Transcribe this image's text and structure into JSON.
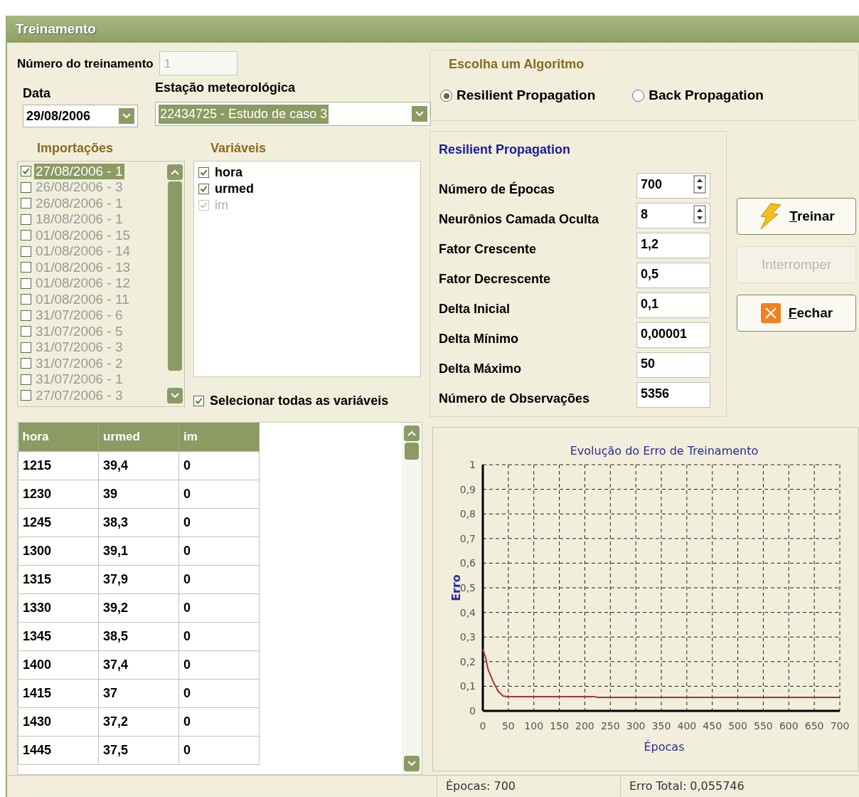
{
  "window": {
    "title": "Treinamento"
  },
  "training_number": {
    "label": "Número do treinamento",
    "value": "1",
    "disabled": true
  },
  "date": {
    "label": "Data",
    "value": "29/08/2006"
  },
  "station": {
    "label": "Estação meteorológica",
    "value": "22434725 - Estudo de caso 3",
    "selected": true
  },
  "imports": {
    "title": "Importações",
    "items": [
      {
        "label": "27/08/2006 - 1",
        "checked": true,
        "selected": true
      },
      {
        "label": "26/08/2006 - 3",
        "checked": false,
        "selected": false
      },
      {
        "label": "26/08/2006 - 1",
        "checked": false,
        "selected": false
      },
      {
        "label": "18/08/2006 - 1",
        "checked": false,
        "selected": false
      },
      {
        "label": "01/08/2006 - 15",
        "checked": false,
        "selected": false
      },
      {
        "label": "01/08/2006 - 14",
        "checked": false,
        "selected": false
      },
      {
        "label": "01/08/2006 - 13",
        "checked": false,
        "selected": false
      },
      {
        "label": "01/08/2006 - 12",
        "checked": false,
        "selected": false
      },
      {
        "label": "01/08/2006 - 11",
        "checked": false,
        "selected": false
      },
      {
        "label": "31/07/2006 - 6",
        "checked": false,
        "selected": false
      },
      {
        "label": "31/07/2006 - 5",
        "checked": false,
        "selected": false
      },
      {
        "label": "31/07/2006 - 3",
        "checked": false,
        "selected": false
      },
      {
        "label": "31/07/2006 - 2",
        "checked": false,
        "selected": false
      },
      {
        "label": "31/07/2006 - 1",
        "checked": false,
        "selected": false
      },
      {
        "label": "27/07/2006 - 3",
        "checked": false,
        "selected": false
      }
    ]
  },
  "variables": {
    "title": "Variáveis",
    "items": [
      {
        "label": "hora",
        "checked": true,
        "disabled": false
      },
      {
        "label": "urmed",
        "checked": true,
        "disabled": false
      },
      {
        "label": "im",
        "checked": true,
        "disabled": true
      }
    ],
    "select_all": {
      "label": "Selecionar todas as variáveis",
      "checked": true
    }
  },
  "table": {
    "columns": [
      "hora",
      "urmed",
      "im"
    ],
    "rows": [
      [
        "1215",
        "39,4",
        "0"
      ],
      [
        "1230",
        "39",
        "0"
      ],
      [
        "1245",
        "38,3",
        "0"
      ],
      [
        "1300",
        "39,1",
        "0"
      ],
      [
        "1315",
        "37,9",
        "0"
      ],
      [
        "1330",
        "39,2",
        "0"
      ],
      [
        "1345",
        "38,5",
        "0"
      ],
      [
        "1400",
        "37,4",
        "0"
      ],
      [
        "1415",
        "37",
        "0"
      ],
      [
        "1430",
        "37,2",
        "0"
      ],
      [
        "1445",
        "37,5",
        "0"
      ]
    ]
  },
  "algorithm": {
    "title": "Escolha um Algoritmo",
    "options": [
      {
        "label": "Resilient Propagation",
        "selected": true
      },
      {
        "label": "Back Propagation",
        "selected": false
      }
    ]
  },
  "parameters": {
    "title": "Resilient Propagation",
    "fields": [
      {
        "label": "Número de Épocas",
        "value": "700",
        "kind": "spin"
      },
      {
        "label": "Neurônios Camada Oculta",
        "value": "8",
        "kind": "spin"
      },
      {
        "label": "Fator Crescente",
        "value": "1,2",
        "kind": "text"
      },
      {
        "label": "Fator Decrescente",
        "value": "0,5",
        "kind": "text"
      },
      {
        "label": "Delta Inicial",
        "value": "0,1",
        "kind": "text"
      },
      {
        "label": "Delta Mínimo",
        "value": "0,00001",
        "kind": "text"
      },
      {
        "label": "Delta Máximo",
        "value": "50",
        "kind": "text"
      },
      {
        "label": "Número de Observações",
        "value": "5356",
        "kind": "text"
      }
    ]
  },
  "buttons": [
    {
      "label": "Treinar",
      "kind": "train",
      "disabled": false
    },
    {
      "label": "Interromper",
      "kind": "plain",
      "disabled": true
    },
    {
      "label": "Fechar",
      "kind": "close",
      "disabled": false
    }
  ],
  "chart": {
    "chart_data": {
      "type": "line",
      "title": "Evolução do Erro de Treinamento",
      "xlabel": "Épocas",
      "ylabel": "Erro",
      "x": [
        0,
        5,
        10,
        20,
        30,
        40,
        50,
        100,
        150,
        200,
        220,
        225,
        300,
        400,
        500,
        600,
        700
      ],
      "grid": true,
      "series": [
        {
          "color": "#b03040",
          "values": [
            0.25,
            0.22,
            0.17,
            0.12,
            0.08,
            0.06,
            0.058,
            0.058,
            0.058,
            0.058,
            0.058,
            0.055,
            0.055,
            0.055,
            0.055,
            0.055,
            0.055
          ]
        }
      ],
      "xlim": [
        0,
        700
      ],
      "ylim": [
        0,
        1
      ],
      "xticks": [
        0,
        50,
        100,
        150,
        200,
        250,
        300,
        350,
        400,
        450,
        500,
        550,
        600,
        650,
        700
      ],
      "yticks": [
        {
          "value": 0,
          "label": "0"
        },
        {
          "value": 0.1,
          "label": "0,1"
        },
        {
          "value": 0.2,
          "label": "0,2"
        },
        {
          "value": 0.3,
          "label": "0,3"
        },
        {
          "value": 0.4,
          "label": "0,4"
        },
        {
          "value": 0.5,
          "label": "0,5"
        },
        {
          "value": 0.6,
          "label": "0,6"
        },
        {
          "value": 0.7,
          "label": "0,7"
        },
        {
          "value": 0.8,
          "label": "0,8"
        },
        {
          "value": 0.9,
          "label": "0,9"
        },
        {
          "value": 1,
          "label": "1"
        }
      ]
    }
  },
  "status_bar": [
    "Épocas: 700",
    "Erro Total: 0,055746"
  ]
}
